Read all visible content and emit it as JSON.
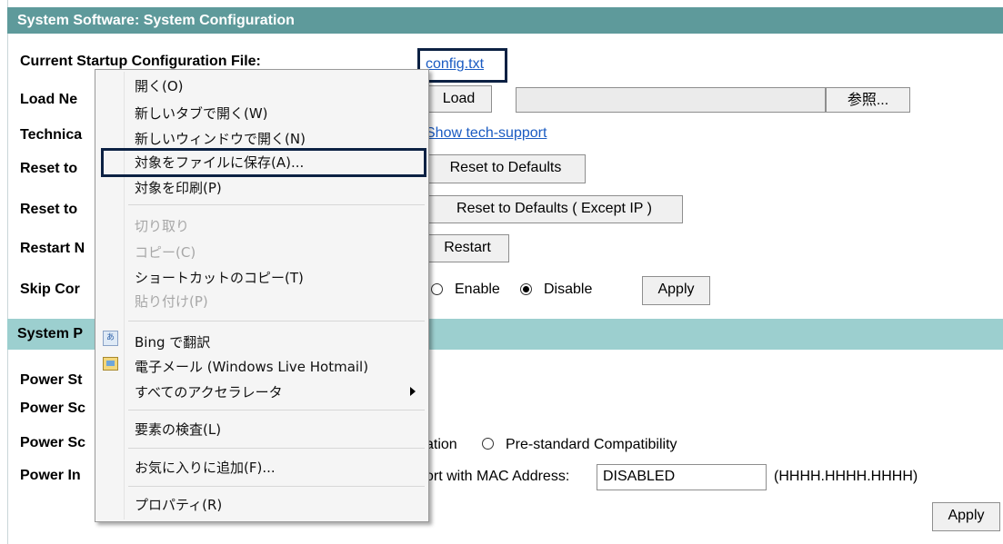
{
  "section1": {
    "title": "System Software: System Configuration",
    "rows": {
      "current_startup": "Current Startup Configuration File:",
      "load_new": "Load Ne",
      "technical": "Technica",
      "reset_to_1": "Reset to",
      "reset_to_2": "Reset to",
      "restart": "Restart N",
      "skip": "Skip Cor"
    },
    "config_link": "config.txt",
    "load_button": "Load",
    "browse_button": "参照...",
    "tech_support_link": "Show tech-support",
    "reset_defaults_button": "Reset to Defaults",
    "reset_defaults_except_ip_button": "Reset to Defaults ( Except IP )",
    "restart_button": "Restart",
    "skip_enable_label": "Enable",
    "skip_disable_label": "Disable",
    "skip_selected": "Disable",
    "apply_button": "Apply"
  },
  "section2": {
    "title": "System P",
    "rows": {
      "power_st": "Power St",
      "power_sc1": "Power Sc",
      "power_sc2": "Power Sc",
      "power_in": "Power In"
    },
    "compat_partial": "ation",
    "prestandard_label": "Pre-standard Compatibility",
    "mac_label_partial": "ort with MAC Address:",
    "mac_value": "DISABLED",
    "mac_format": "(HHHH.HHHH.HHHH)",
    "apply_button": "Apply"
  },
  "context_menu": {
    "items": [
      {
        "label": "開く(O)",
        "enabled": true
      },
      {
        "label": "新しいタブで開く(W)",
        "enabled": true
      },
      {
        "label": "新しいウィンドウで開く(N)",
        "enabled": true
      },
      {
        "label": "対象をファイルに保存(A)...",
        "enabled": true,
        "highlighted": true
      },
      {
        "label": "対象を印刷(P)",
        "enabled": true
      },
      {
        "label": "切り取り",
        "enabled": false
      },
      {
        "label": "コピー(C)",
        "enabled": false
      },
      {
        "label": "ショートカットのコピー(T)",
        "enabled": true
      },
      {
        "label": "貼り付け(P)",
        "enabled": false
      },
      {
        "label": "Bing で翻訳",
        "enabled": true,
        "icon": "bing-translate-icon"
      },
      {
        "label": "電子メール (Windows Live Hotmail)",
        "enabled": true,
        "icon": "email-icon"
      },
      {
        "label": "すべてのアクセラレータ",
        "enabled": true,
        "submenu": true
      },
      {
        "label": "要素の検査(L)",
        "enabled": true
      },
      {
        "label": "お気に入りに追加(F)...",
        "enabled": true
      },
      {
        "label": "プロパティ(R)",
        "enabled": true
      }
    ]
  },
  "colors": {
    "header_dark": "#5e9a9b",
    "header_light": "#9ccfcf",
    "link": "#1a5bc2",
    "highlight_box": "#0c2143"
  }
}
